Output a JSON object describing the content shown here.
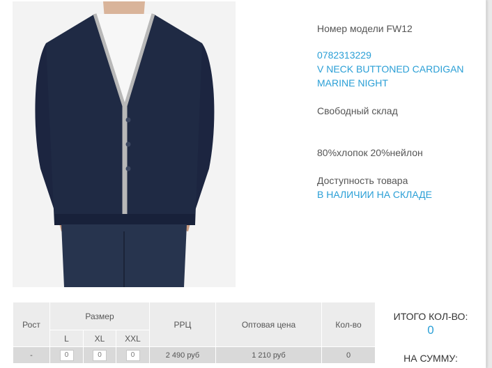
{
  "product": {
    "model_label": "Номер модели FW12",
    "article": "0782313229",
    "name_line1": "V NECK BUTTONED CARDIGAN",
    "name_line2": "MARINE NIGHT",
    "warehouse": "Свободный склад",
    "composition": "80%хлопок 20%нейлон",
    "availability_label": "Доступность товара",
    "availability_value": "В НАЛИЧИИ НА СКЛАДЕ",
    "image": "product-photo-cardigan"
  },
  "table": {
    "headers": {
      "height": "Рост",
      "size": "Размер",
      "rrp": "РРЦ",
      "wholesale": "Оптовая цена",
      "qty": "Кол-во"
    },
    "sizes": [
      "L",
      "XL",
      "XXL"
    ],
    "row": {
      "height": "-",
      "qty_l": "0",
      "qty_xl": "0",
      "qty_xxl": "0",
      "rrp": "2 490 руб",
      "wholesale": "1 210 руб",
      "qty": "0"
    }
  },
  "totals": {
    "qty_label": "ИТОГО КОЛ-ВО:",
    "qty_value": "0",
    "sum_label": "НА СУММУ:"
  },
  "colors": {
    "link": "#2a9fd6",
    "text": "#555555",
    "cardigan": "#1f2a44",
    "trim": "#b8b8b8"
  }
}
